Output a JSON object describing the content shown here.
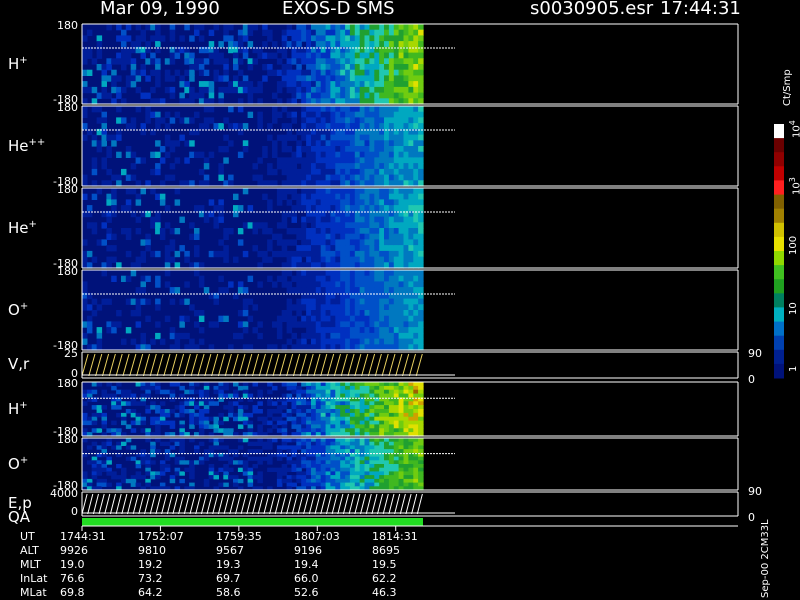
{
  "header": {
    "date": "Mar 09, 1990",
    "instrument": "EXOS-D SMS",
    "file": "s0030905.esr",
    "time": "17:44:31"
  },
  "colorbar": {
    "unit": "Ct/Smp",
    "labels": [
      "1",
      "10",
      "100",
      "10",
      "10"
    ],
    "exponents": [
      "",
      "",
      "",
      "3",
      "4"
    ]
  },
  "footer": {
    "rows": [
      {
        "label": "UT",
        "values": [
          "1744:31",
          "1752:07",
          "1759:35",
          "1807:03",
          "1814:31"
        ]
      },
      {
        "label": "ALT",
        "values": [
          "9926",
          "9810",
          "9567",
          "9196",
          "8695"
        ]
      },
      {
        "label": "MLT",
        "values": [
          "19.0",
          "19.2",
          "19.3",
          "19.4",
          "19.5"
        ]
      },
      {
        "label": "InLat",
        "values": [
          "76.6",
          "73.2",
          "69.7",
          "66.0",
          "62.2"
        ]
      },
      {
        "label": "MLat",
        "values": [
          "69.8",
          "64.2",
          "58.6",
          "52.6",
          "46.3"
        ]
      }
    ],
    "stamp": "Sep-00 2CM33L"
  },
  "colors": {
    "background": "#000000",
    "empty_panel": "#00127a"
  },
  "chart_data": {
    "type": "heatmap",
    "title": "Mar 09, 1990   EXOS-D SMS",
    "x_ticks": [
      "1744:31",
      "1752:07",
      "1759:35",
      "1807:03",
      "1814:31"
    ],
    "data_fraction_of_axis": 0.52,
    "color_scale": {
      "type": "log",
      "range": [
        1,
        10000
      ],
      "unit": "Ct/Smp"
    },
    "panels": [
      {
        "label": "H",
        "sup": "+",
        "kind": "spectrogram",
        "ylim": [
          -180,
          180
        ],
        "yticks": [
          "180",
          "-180"
        ],
        "activity": 0.8
      },
      {
        "label": "He",
        "sup": "++",
        "kind": "spectrogram",
        "ylim": [
          -180,
          180
        ],
        "yticks": [
          "180",
          "-180"
        ],
        "activity": 0.45
      },
      {
        "label": "He",
        "sup": "+",
        "kind": "spectrogram",
        "ylim": [
          -180,
          180
        ],
        "yticks": [
          "180",
          "-180"
        ],
        "activity": 0.45
      },
      {
        "label": "O",
        "sup": "+",
        "kind": "spectrogram",
        "ylim": [
          -180,
          180
        ],
        "yticks": [
          "180",
          "-180"
        ],
        "activity": 0.4
      },
      {
        "label": "V,r",
        "sup": "",
        "kind": "line",
        "ylim": [
          0,
          25
        ],
        "yticks": [
          "25",
          "0"
        ],
        "right_ticks": [
          "90",
          "0"
        ]
      },
      {
        "label": "H",
        "sup": "+",
        "kind": "spectrogram",
        "ylim": [
          -180,
          180
        ],
        "yticks": [
          "180",
          "-180"
        ],
        "activity": 0.95
      },
      {
        "label": "O",
        "sup": "+",
        "kind": "spectrogram",
        "ylim": [
          -180,
          180
        ],
        "yticks": [
          "180",
          "-180"
        ],
        "activity": 0.75
      },
      {
        "label": "E,p",
        "sup": "",
        "kind": "line",
        "ylim": [
          0,
          4000
        ],
        "yticks": [
          "4000",
          "0"
        ],
        "right_ticks": [
          "90",
          "0"
        ]
      }
    ],
    "qa": {
      "label": "QA",
      "color": "#22dd22"
    }
  }
}
